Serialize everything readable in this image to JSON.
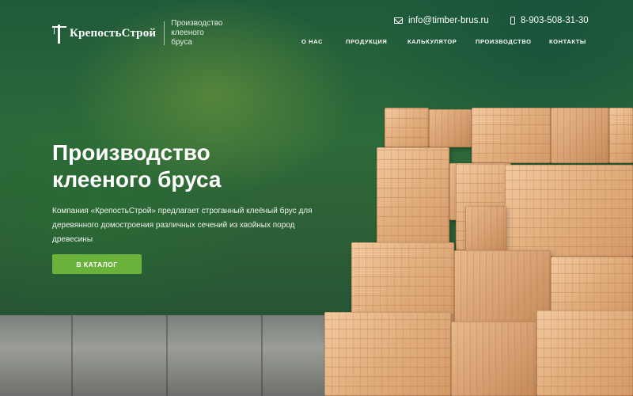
{
  "header": {
    "logo_text": "КрепостьСтрой",
    "tagline": "Производство клееного бруса",
    "email": "info@timber-brus.ru",
    "phone": "8-903-508-31-30"
  },
  "nav": {
    "items": [
      {
        "label": "О НАС"
      },
      {
        "label": "ПРОДУКЦИЯ"
      },
      {
        "label": "КАЛЬКУЛЯТОР"
      },
      {
        "label": "ПРОИЗВОДСТВО"
      },
      {
        "label": "КОНТАКТЫ"
      }
    ]
  },
  "hero": {
    "headline_line1": "Производство",
    "headline_line2": "клееного бруса",
    "subtitle": "Компания «КрепостьСтрой» предлагает строганный клеёный брус для деревянного домостроения различных сечений из хвойных пород древесины",
    "cta_label": "В КАТАЛОГ"
  },
  "colors": {
    "accent_green": "#6bb23a",
    "background_green": "#2e6a3a"
  },
  "icons": {
    "email": "mail-icon",
    "phone": "phone-icon",
    "logo": "crane-icon"
  }
}
